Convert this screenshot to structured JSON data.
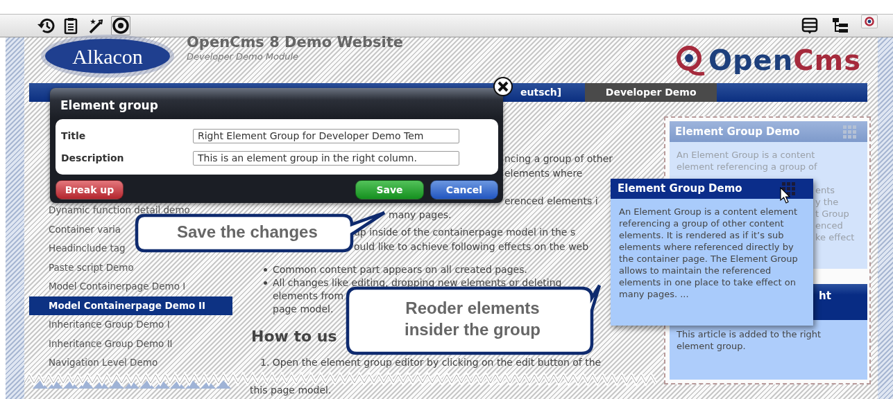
{
  "toolbar": {
    "left": [
      {
        "kind": "history",
        "selected": false
      },
      {
        "kind": "clipboard",
        "selected": false
      },
      {
        "kind": "wand",
        "selected": false
      },
      {
        "kind": "target",
        "selected": true
      }
    ],
    "right": [
      {
        "kind": "list",
        "selected": false
      },
      {
        "kind": "tree",
        "selected": false
      },
      {
        "kind": "target",
        "selected": true
      }
    ]
  },
  "site": {
    "brand": "Alkacon",
    "title": "OpenCms 8 Demo Website",
    "subtitle": "Developer Demo Module",
    "logo": "OpenCms"
  },
  "nav": [
    {
      "label": "eutsch]",
      "selected": false
    },
    {
      "label": "Developer Demo",
      "selected": true
    }
  ],
  "sidebar": {
    "items": [
      {
        "label": "Dynamic function detail demo",
        "selected": false
      },
      {
        "label": "Container varia",
        "selected": false
      },
      {
        "label": "Headinclude tag",
        "selected": false
      },
      {
        "label": "Paste script Demo",
        "selected": false
      },
      {
        "label": "Model Containerpage Demo I",
        "selected": false
      },
      {
        "label": "Model Containerpage Demo II",
        "selected": true
      },
      {
        "label": "Inheritance Group Demo I",
        "selected": false
      },
      {
        "label": "Inheritance Group Demo II",
        "selected": false
      },
      {
        "label": "Navigation Level Demo",
        "selected": false
      }
    ]
  },
  "content": {
    "lines": [
      {
        "kind": "text",
        "text": "ncing a group of other"
      },
      {
        "kind": "text",
        "text": "elements where"
      },
      {
        "kind": "text",
        "text": "erenced elements i"
      },
      {
        "kind": "text",
        "text": "many pages."
      },
      {
        "kind": "text",
        "text": "up inside of the containerpage model in the s"
      },
      {
        "kind": "text",
        "text": "ould like to achieve following effects on the web"
      },
      {
        "kind": "bullet",
        "text": "Common content part appears on all created pages."
      },
      {
        "kind": "bullet",
        "text": "All changes like editing, dropping new elements or deleting"
      },
      {
        "kind": "text",
        "text": "elements from"
      },
      {
        "kind": "text",
        "text": "page model."
      },
      {
        "kind": "heading",
        "text": "How to us"
      },
      {
        "kind": "text",
        "text": "1.  Open the element group editor by clicking on the edit button of the"
      },
      {
        "kind": "text",
        "text": "this page model."
      }
    ]
  },
  "right_column": {
    "group": {
      "title": "Element Group Demo",
      "lines": [
        "An Element Group is a content",
        "element referencing a group of",
        "ents",
        "y the",
        "t Group",
        "enced",
        "ke effect"
      ]
    },
    "article": {
      "title": "ht",
      "text": "This article is added to the right element group."
    }
  },
  "drag_preview": {
    "title": "Element Group Demo",
    "text": "An Element Group is a content element referencing a group of other content elements. It is rendered as if it’s sub elements where referenced directly by the container page. The Element Group allows to maintain the referenced elements in one place to take effect on many pages. ..."
  },
  "dialog": {
    "title": "Element group",
    "fields": [
      {
        "label": "Title",
        "value": "Right Element Group for Developer Demo Tem"
      },
      {
        "label": "Description",
        "value": "This is an element group in the right column."
      }
    ],
    "buttons": [
      {
        "kind": "danger",
        "label": "Break up"
      },
      {
        "kind": "success",
        "label": "Save"
      },
      {
        "kind": "primary",
        "label": "Cancel"
      }
    ]
  },
  "callouts": [
    {
      "lines": [
        "Save the changes"
      ]
    },
    {
      "lines": [
        "Reoder elements",
        "insider the group"
      ]
    }
  ]
}
